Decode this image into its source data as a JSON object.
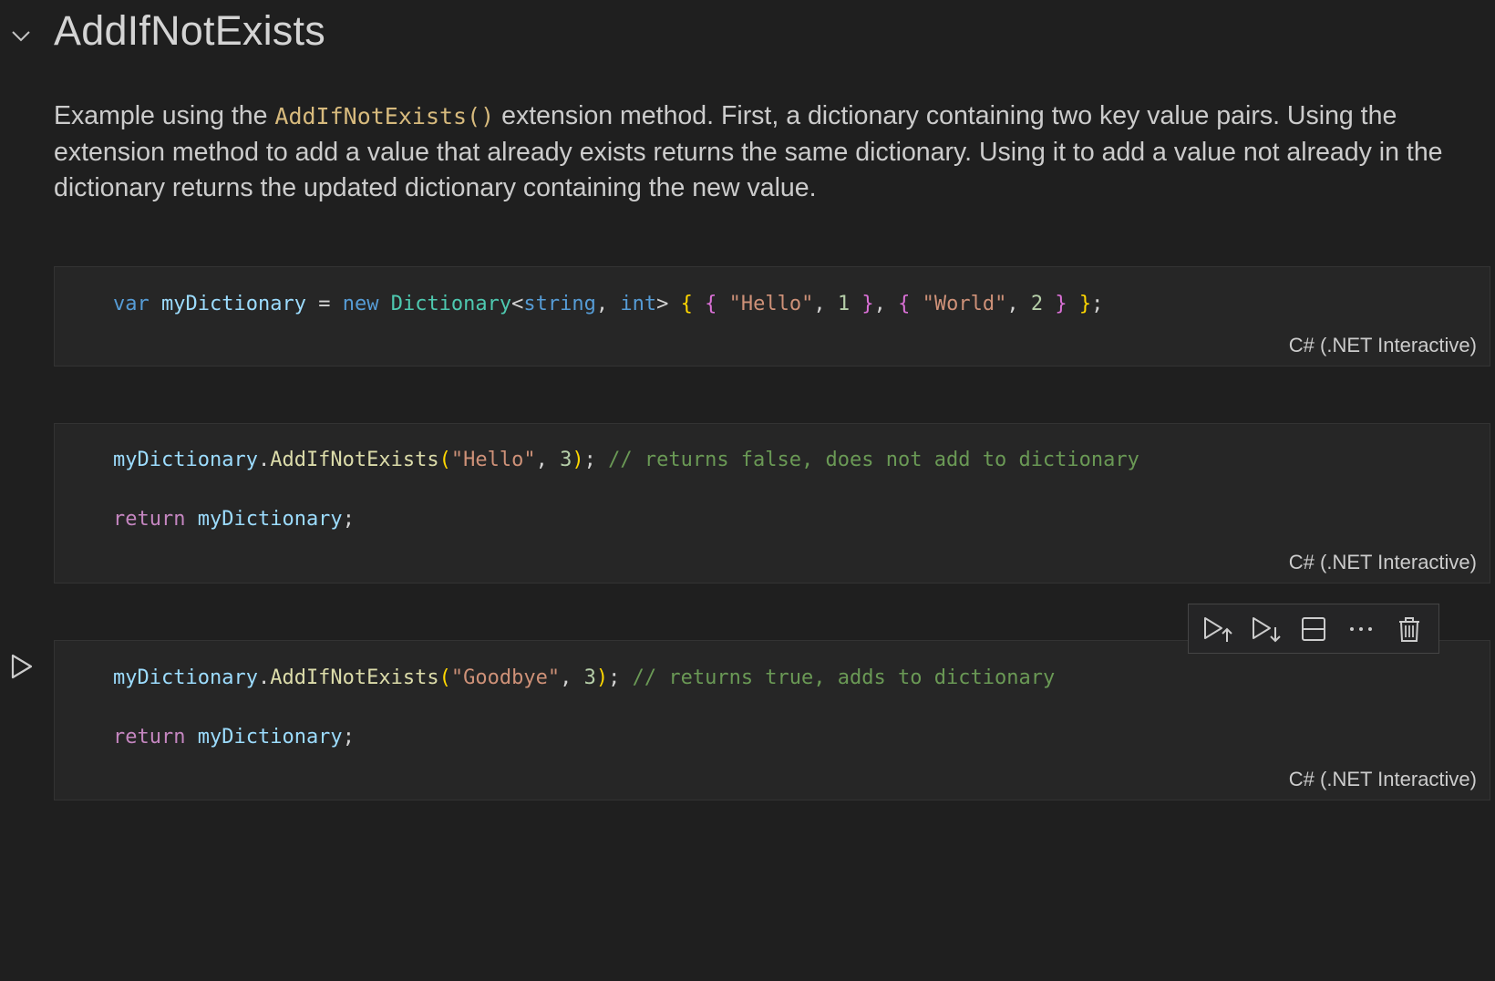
{
  "section": {
    "title": "AddIfNotExists"
  },
  "markdown": {
    "text_before": "Example using the ",
    "inline_code": "AddIfNotExists()",
    "text_after": " extension method. First, a dictionary containing two key value pairs. Using the extension method to add a value that already exists returns the same dictionary. Using it to add a value not already in the dictionary returns the updated dictionary containing the new value."
  },
  "cells": [
    {
      "language": "C# (.NET Interactive)",
      "lines": [
        {
          "tokens": [
            {
              "t": "var",
              "c": "kw"
            },
            {
              "t": " ",
              "c": "pl"
            },
            {
              "t": "myDictionary",
              "c": "var"
            },
            {
              "t": " = ",
              "c": "pl"
            },
            {
              "t": "new",
              "c": "kw"
            },
            {
              "t": " ",
              "c": "pl"
            },
            {
              "t": "Dictionary",
              "c": "type"
            },
            {
              "t": "<",
              "c": "pl"
            },
            {
              "t": "string",
              "c": "kw"
            },
            {
              "t": ", ",
              "c": "pl"
            },
            {
              "t": "int",
              "c": "kw"
            },
            {
              "t": "> ",
              "c": "pl"
            },
            {
              "t": "{",
              "c": "b1"
            },
            {
              "t": " ",
              "c": "pl"
            },
            {
              "t": "{",
              "c": "b2"
            },
            {
              "t": " ",
              "c": "pl"
            },
            {
              "t": "\"Hello\"",
              "c": "str"
            },
            {
              "t": ", ",
              "c": "pl"
            },
            {
              "t": "1",
              "c": "num"
            },
            {
              "t": " ",
              "c": "pl"
            },
            {
              "t": "}",
              "c": "b2"
            },
            {
              "t": ", ",
              "c": "pl"
            },
            {
              "t": "{",
              "c": "b2"
            },
            {
              "t": " ",
              "c": "pl"
            },
            {
              "t": "\"World\"",
              "c": "str"
            },
            {
              "t": ", ",
              "c": "pl"
            },
            {
              "t": "2",
              "c": "num"
            },
            {
              "t": " ",
              "c": "pl"
            },
            {
              "t": "}",
              "c": "b2"
            },
            {
              "t": " ",
              "c": "pl"
            },
            {
              "t": "}",
              "c": "b1"
            },
            {
              "t": ";",
              "c": "pl"
            }
          ]
        }
      ]
    },
    {
      "language": "C# (.NET Interactive)",
      "lines": [
        {
          "tokens": [
            {
              "t": "myDictionary",
              "c": "var"
            },
            {
              "t": ".",
              "c": "pl"
            },
            {
              "t": "AddIfNotExists",
              "c": "fn"
            },
            {
              "t": "(",
              "c": "b1"
            },
            {
              "t": "\"Hello\"",
              "c": "str"
            },
            {
              "t": ", ",
              "c": "pl"
            },
            {
              "t": "3",
              "c": "num"
            },
            {
              "t": ")",
              "c": "b1"
            },
            {
              "t": "; ",
              "c": "pl"
            },
            {
              "t": "// returns false, does not add to dictionary",
              "c": "cmt"
            }
          ]
        },
        {
          "tokens": [
            {
              "t": "return",
              "c": "ctl"
            },
            {
              "t": " ",
              "c": "pl"
            },
            {
              "t": "myDictionary",
              "c": "var"
            },
            {
              "t": ";",
              "c": "pl"
            }
          ]
        }
      ]
    },
    {
      "language": "C# (.NET Interactive)",
      "lines": [
        {
          "tokens": [
            {
              "t": "myDictionary",
              "c": "var"
            },
            {
              "t": ".",
              "c": "pl"
            },
            {
              "t": "AddIfNotExists",
              "c": "fn"
            },
            {
              "t": "(",
              "c": "b1"
            },
            {
              "t": "\"Goodbye\"",
              "c": "str"
            },
            {
              "t": ", ",
              "c": "pl"
            },
            {
              "t": "3",
              "c": "num"
            },
            {
              "t": ")",
              "c": "b1"
            },
            {
              "t": "; ",
              "c": "pl"
            },
            {
              "t": "// returns true, adds to dictionary",
              "c": "cmt"
            }
          ]
        },
        {
          "tokens": [
            {
              "t": "return",
              "c": "ctl"
            },
            {
              "t": " ",
              "c": "pl"
            },
            {
              "t": "myDictionary",
              "c": "var"
            },
            {
              "t": ";",
              "c": "pl"
            }
          ]
        }
      ]
    }
  ],
  "cell_toolbar": {
    "buttons": [
      {
        "icon": "run-above-icon"
      },
      {
        "icon": "run-below-icon"
      },
      {
        "icon": "split-cell-icon"
      },
      {
        "icon": "more-actions-icon"
      },
      {
        "icon": "delete-cell-icon"
      }
    ]
  },
  "colors": {
    "background": "#1f1f1f",
    "cell_background": "#262626",
    "keyword": "#569cd6",
    "control": "#c586c0",
    "variable": "#9cdcfe",
    "type": "#4ec9b0",
    "string": "#ce9178",
    "number": "#b5cea8",
    "function": "#dcdcaa",
    "comment": "#6a9955"
  }
}
